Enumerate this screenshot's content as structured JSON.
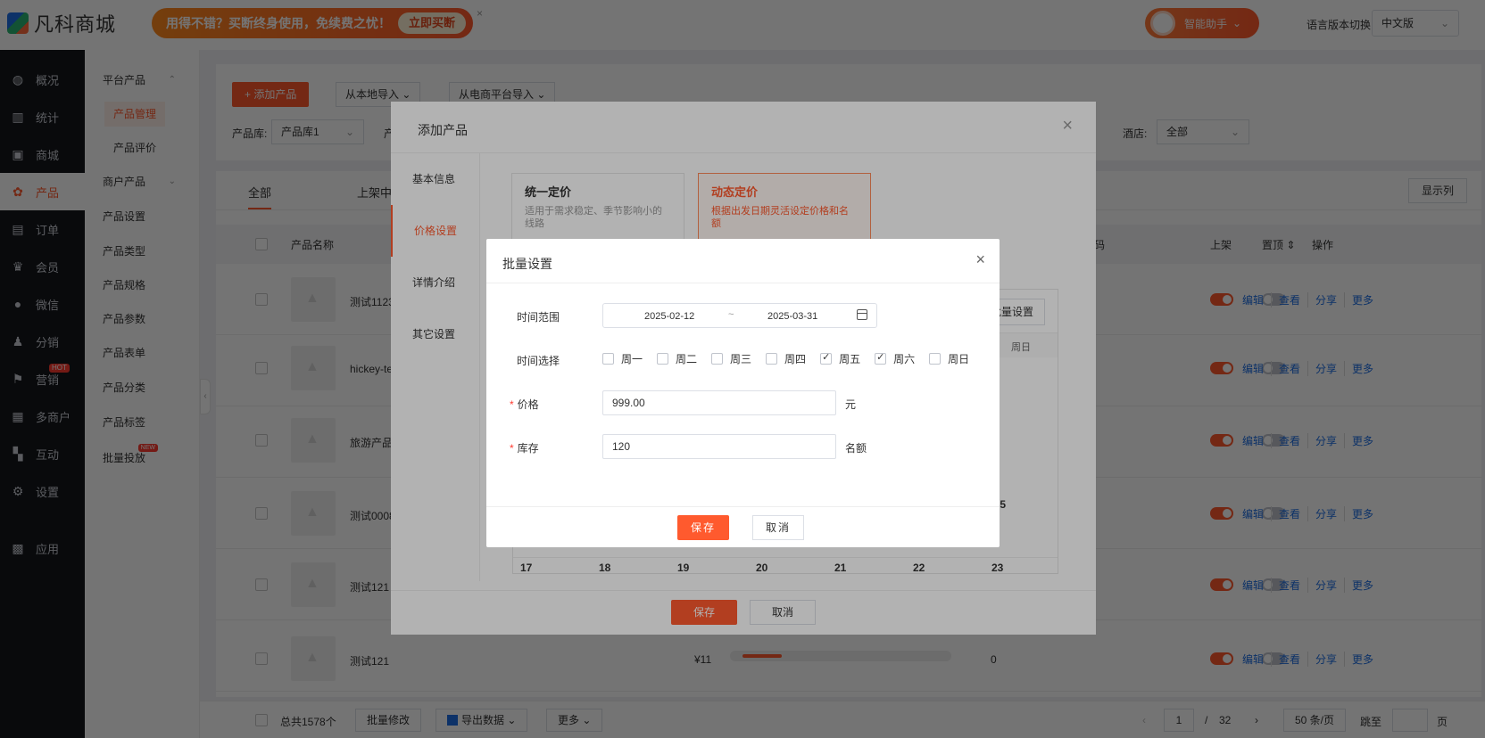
{
  "topbar": {
    "logo_text": "凡科商城",
    "promo_text": "用得不错？买断终身使用，免续费之忧！",
    "promo_button": "立即买断",
    "promo_close": "×",
    "assistant_label": "智能助手",
    "assistant_caret": "⌄",
    "lang_label": "语言版本切换:",
    "lang_value": "中文版",
    "lang_caret": "⌄"
  },
  "sidenav": {
    "items": [
      {
        "label": "概况",
        "icon": "dashboard-icon"
      },
      {
        "label": "统计",
        "icon": "chart-icon"
      },
      {
        "label": "商城",
        "icon": "shop-icon"
      },
      {
        "label": "产品",
        "icon": "product-icon"
      },
      {
        "label": "订单",
        "icon": "order-icon"
      },
      {
        "label": "会员",
        "icon": "crown-icon"
      },
      {
        "label": "微信",
        "icon": "wechat-icon"
      },
      {
        "label": "分销",
        "icon": "distribution-icon"
      },
      {
        "label": "营销",
        "icon": "flag-icon",
        "badge": "HOT"
      },
      {
        "label": "多商户",
        "icon": "merchant-icon"
      },
      {
        "label": "互动",
        "icon": "interaction-icon"
      },
      {
        "label": "设置",
        "icon": "gear-icon"
      },
      {
        "label": "应用",
        "icon": "apps-icon"
      }
    ]
  },
  "subnav": {
    "platform_group": "平台产品",
    "platform_caret": "⌃",
    "product_manage": "产品管理",
    "product_review": "产品评价",
    "merchant_group": "商户产品",
    "merchant_caret": "⌄",
    "items": [
      "产品设置",
      "产品类型",
      "产品规格",
      "产品参数",
      "产品表单",
      "产品分类",
      "产品标签",
      "批量投放"
    ],
    "new_badge": "NEW",
    "collapse": "‹"
  },
  "toolbar": {
    "add_button": "+ 添加产品",
    "import_local": "从本地导入",
    "import_ecom": "从电商平台导入",
    "caret": "⌄",
    "lib_label": "产品库:",
    "lib_value": "产品库1",
    "lib_label2": "产",
    "hotel_label": "酒店:",
    "hotel_value": "全部"
  },
  "table": {
    "tabs": [
      "全部",
      "上架中"
    ],
    "show_columns": "显示列",
    "headers": {
      "name": "产品名称",
      "code": "码",
      "shelf": "上架",
      "top": "置顶",
      "top_sort": "⇕",
      "ops": "操作"
    },
    "rows": [
      {
        "name": "测试1123"
      },
      {
        "name": "hickey-te"
      },
      {
        "name": "旅游产品"
      },
      {
        "name": "测试0008"
      },
      {
        "name": "测试121"
      },
      {
        "name": "测试121",
        "price": "¥11",
        "stock": "0"
      }
    ],
    "ops": [
      "编辑",
      "查看",
      "分享",
      "更多"
    ]
  },
  "footer": {
    "total": "总共1578个",
    "batch_modify": "批量修改",
    "export": "导出数据",
    "more": "更多",
    "caret": "⌄",
    "prev": "‹",
    "page": "1",
    "page_sep": "/",
    "page_total": "32",
    "next": "›",
    "page_size": "50 条/页",
    "jump_label": "跳至",
    "jump_unit": "页"
  },
  "add_dialog": {
    "title": "添加产品",
    "close": "×",
    "side_tabs": [
      "基本信息",
      "价格设置",
      "详情介绍",
      "其它设置"
    ],
    "unified_title": "统一定价",
    "unified_desc": "适用于需求稳定、季节影响小的线路",
    "dynamic_title": "动态定价",
    "dynamic_desc": "根据出发日期灵活设定价格和名额",
    "batch_set": "批量设置",
    "sunday": "周日",
    "day5": "5",
    "days_row": [
      "17",
      "18",
      "19",
      "20",
      "21",
      "22",
      "23"
    ],
    "save": "保存",
    "cancel": "取消"
  },
  "batch_dialog": {
    "title": "批量设置",
    "close": "×",
    "range_label": "时间范围",
    "range_start": "2025-02-12",
    "range_sep": "~",
    "range_end": "2025-03-31",
    "days_label": "时间选择",
    "weekdays": [
      {
        "label": "周一",
        "checked": false
      },
      {
        "label": "周二",
        "checked": false
      },
      {
        "label": "周三",
        "checked": false
      },
      {
        "label": "周四",
        "checked": false
      },
      {
        "label": "周五",
        "checked": true
      },
      {
        "label": "周六",
        "checked": true
      },
      {
        "label": "周日",
        "checked": false
      }
    ],
    "required_mark": "*",
    "price_label": "价格",
    "price_value": "999.00",
    "price_unit": "元",
    "stock_label": "库存",
    "stock_value": "120",
    "stock_unit": "名额",
    "save": "保存",
    "cancel": "取消"
  },
  "colors": {
    "accent": "#ff5a2e",
    "link": "#1f6fe5"
  }
}
